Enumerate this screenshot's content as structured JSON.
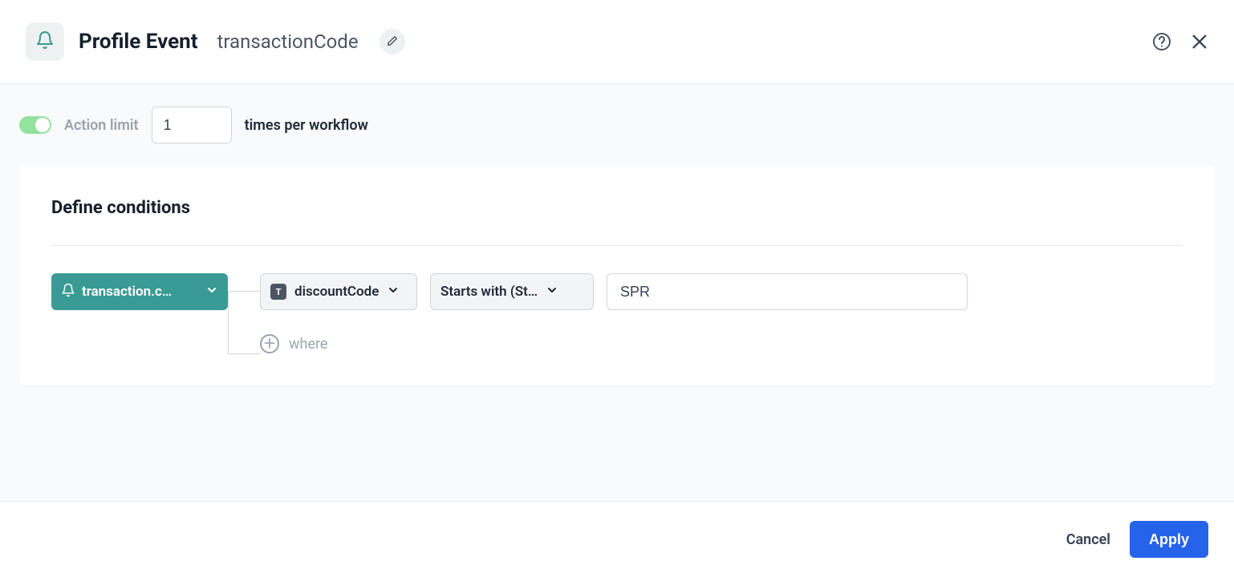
{
  "header": {
    "title": "Profile Event",
    "subtitle": "transactionCode"
  },
  "actionLimit": {
    "label": "Action limit",
    "value": "1",
    "suffix": "times per workflow"
  },
  "conditions": {
    "title": "Define conditions",
    "event": "transaction.c…",
    "field": {
      "typeBadge": "T",
      "name": "discountCode"
    },
    "operator": "Starts with (St…",
    "value": "SPR",
    "addWhere": "where"
  },
  "footer": {
    "cancel": "Cancel",
    "apply": "Apply"
  }
}
